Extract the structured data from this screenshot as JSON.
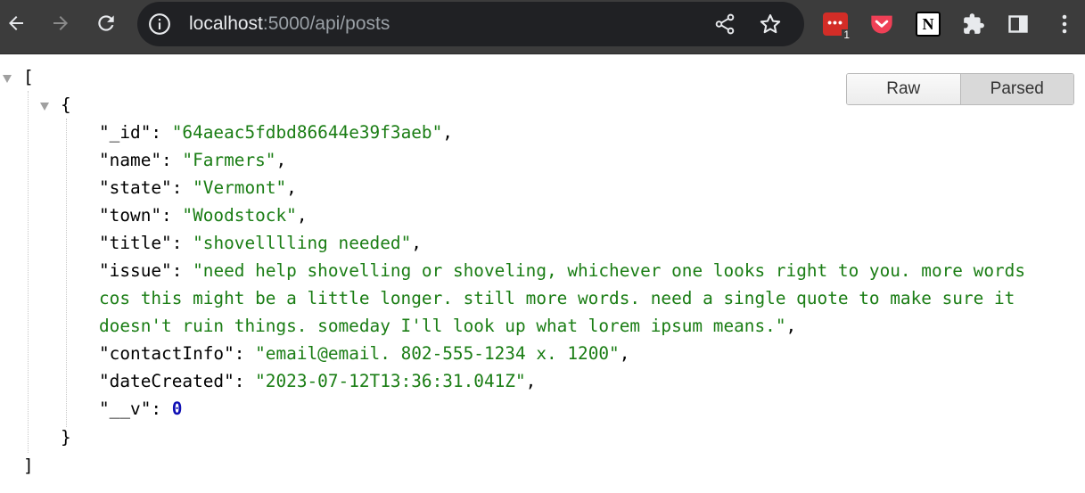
{
  "browser": {
    "url_host": "localhost",
    "url_rest": ":5000/api/posts",
    "lastpass_badge": "1",
    "lastpass_dots": "•••",
    "notion_letter": "N",
    "icons": {
      "back": "back-arrow-icon",
      "forward": "forward-arrow-icon",
      "reload": "reload-icon",
      "info": "info-icon",
      "share": "share-icon",
      "bookmark": "star-icon",
      "lastpass": "lastpass-icon",
      "pocket": "pocket-icon",
      "notion": "notion-icon",
      "extensions": "puzzle-icon",
      "side_panel": "side-panel-icon",
      "menu": "kebab-menu-icon"
    },
    "colors": {
      "toolbar": "#3c3c3c",
      "omnibox": "#202124",
      "lastpass": "#d32d27",
      "pocket": "#ef4056"
    }
  },
  "viewer": {
    "raw_label": "Raw",
    "parsed_label": "Parsed",
    "selected": "Parsed",
    "colors": {
      "string": "#1a7d14",
      "number": "#1010b5"
    }
  },
  "json": {
    "open_bracket": "[",
    "close_bracket": "]",
    "open_brace": "{",
    "close_brace": "}",
    "rows": [
      {
        "key": "\"_id\"",
        "value": "\"64aeac5fdbd86644e39f3aeb\"",
        "suffix": ","
      },
      {
        "key": "\"name\"",
        "value": "\"Farmers\"",
        "suffix": ","
      },
      {
        "key": "\"state\"",
        "value": "\"Vermont\"",
        "suffix": ","
      },
      {
        "key": "\"town\"",
        "value": "\"Woodstock\"",
        "suffix": ","
      },
      {
        "key": "\"title\"",
        "value": "\"shovelllling needed\"",
        "suffix": ","
      },
      {
        "key": "\"issue\"",
        "value_lines": [
          "\"need help shovelling or shoveling, whichever one looks right to you. more words",
          "cos this might be a little longer. still more words. need a single quote to make sure it",
          "doesn't ruin things. someday I'll look up what lorem ipsum means.\""
        ],
        "suffix": ","
      },
      {
        "key": "\"contactInfo\"",
        "value": "\"email@email. 802-555-1234 x. 1200\"",
        "suffix": ","
      },
      {
        "key": "\"dateCreated\"",
        "value": "\"2023-07-12T13:36:31.041Z\"",
        "suffix": ","
      },
      {
        "key": "\"__v\"",
        "value": "0",
        "suffix": ""
      }
    ]
  }
}
